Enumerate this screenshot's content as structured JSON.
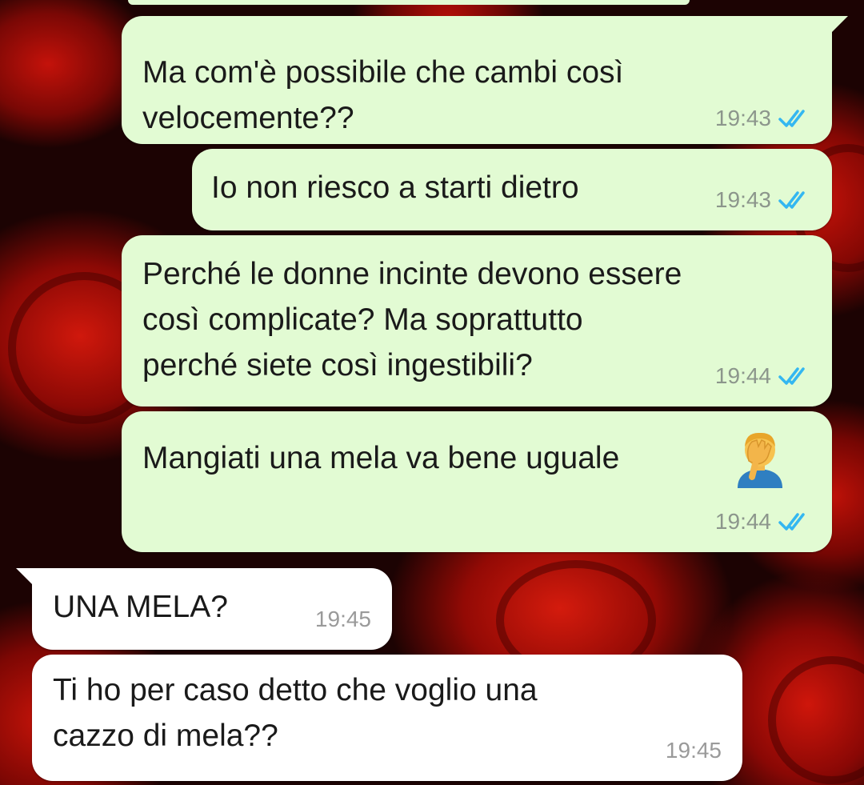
{
  "messages": [
    {
      "direction": "outgoing",
      "text": "Ma com'è possibile che cambi così\nvelocemente??",
      "time": "19:43",
      "status": "read"
    },
    {
      "direction": "outgoing",
      "text": "Io non riesco a starti dietro",
      "time": "19:43",
      "status": "read"
    },
    {
      "direction": "outgoing",
      "text": "Perché le donne incinte devono essere\ncosì complicate? Ma soprattutto\nperché siete così ingestibili?",
      "time": "19:44",
      "status": "read"
    },
    {
      "direction": "outgoing",
      "text": "Mangiati una mela va bene uguale",
      "emoji": "face-palm-man",
      "time": "19:44",
      "status": "read"
    },
    {
      "direction": "incoming",
      "text": "UNA MELA?",
      "time": "19:45"
    },
    {
      "direction": "incoming",
      "text": "Ti ho per caso detto che voglio una\ncazzo di mela??",
      "time": "19:45"
    }
  ],
  "colors": {
    "outgoing_bubble": "#e2fbd3",
    "incoming_bubble": "#ffffff",
    "read_ticks": "#34b7f1",
    "timestamp": "#8c968c",
    "wallpaper_accent": "#c4120a"
  },
  "icons": {
    "read_receipt": "double-check-icon",
    "emoji": "face-palm-emoji-icon"
  }
}
